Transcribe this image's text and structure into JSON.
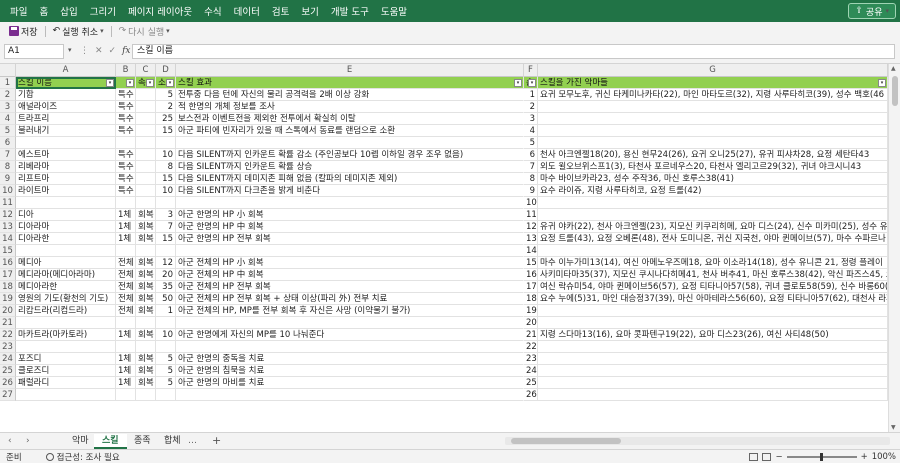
{
  "menu": [
    "파일",
    "홈",
    "삽입",
    "그리기",
    "페이지 레이아웃",
    "수식",
    "데이터",
    "검토",
    "보기",
    "개발 도구",
    "도움말"
  ],
  "share_label": "공유",
  "toolbar": {
    "save": "저장",
    "undo": "실행 취소",
    "redo": "다시 실행"
  },
  "namebox": "A1",
  "formula": "스킬 이름",
  "columns": [
    "A",
    "B",
    "C",
    "D",
    "E",
    "F",
    "G"
  ],
  "header": [
    "스킬 이름",
    "",
    "속",
    "소",
    "스킬 효과",
    "순",
    "스킬을 가진 악마들"
  ],
  "rows": [
    [
      "2",
      "기합",
      "특수",
      "",
      "5",
      "전투중 다음 턴에 자신의 물리 공격력을 2배 이상 강화",
      "1",
      "요귀 모무노후, 귀신 타케미나카타(22), 마인 마타도르(32), 지령 사루타히코(39), 성수 백호(46"
    ],
    [
      "3",
      "애널라이즈",
      "특수",
      "",
      "2",
      "적 한명의 개체 정보를 조사",
      "2",
      ""
    ],
    [
      "4",
      "트라프리",
      "특수",
      "",
      "25",
      "보스전과 이벤트전을 제외한 전투에서 확실히 이탈",
      "3",
      ""
    ],
    [
      "5",
      "불러내기",
      "특수",
      "",
      "15",
      "아군 파티에 빈자리가 있을 때 스톡에서 동료를 랜덤으로 소환",
      "4",
      ""
    ],
    [
      "6",
      "",
      "",
      "",
      "",
      "",
      "5",
      ""
    ],
    [
      "7",
      "에스트마",
      "특수",
      "",
      "10",
      "다음 SILENT까지 인카운트 확률 감소 (주인공보다 10렙 이하일 경우 조우 없음)",
      "6",
      "천사 아크엔젤18(20), 용신 현무24(26), 요귀 오니25(27), 유귀 피샤차28, 요정 세탄타43"
    ],
    [
      "8",
      "리베라마",
      "특수",
      "",
      "8",
      "다음 SILENT까지 인카운트 확률 상승",
      "7",
      "외도 윌오브위스프1(3), 타천사 포르네우스20, 타천사 엘리고르29(32), 귀녀 야크시니43"
    ],
    [
      "9",
      "리프트마",
      "특수",
      "",
      "15",
      "다음 SILENT까지 데미지존 피해 없음 (칼파의 데미지존 제외)",
      "8",
      "마수 바이브카라23, 성수 주작36, 마신 호루스38(41)"
    ],
    [
      "10",
      "라이트마",
      "특수",
      "",
      "10",
      "다음 SILENT까지 다크존을 밝게 비춘다",
      "9",
      "요수 라이쥬, 지령 사루타히코, 요정 트롤(42)"
    ],
    [
      "11",
      "",
      "",
      "",
      "",
      "",
      "10",
      ""
    ],
    [
      "12",
      "디아",
      "1체",
      "회복",
      "3",
      "아군 한명의 HP 小 회복",
      "11",
      ""
    ],
    [
      "13",
      "디아라마",
      "1체",
      "회복",
      "7",
      "아군 한명의 HP 中 회복",
      "12",
      "유귀 야카(22), 천사 아크엔젤(23), 지모신 키쿠리히메, 요마 디스(24), 신수 미카미(25), 성수 유니"
    ],
    [
      "14",
      "디아라한",
      "1체",
      "회복",
      "15",
      "아군 한명의 HP 전부 회복",
      "13",
      "요정 트롤(43), 요정 오베론(48), 전사 도미니온, 귀신 지국천, 야마 퀸메이브(57), 마수 수파르나"
    ],
    [
      "15",
      "",
      "",
      "",
      "",
      "",
      "14",
      ""
    ],
    [
      "16",
      "메디아",
      "전체",
      "회복",
      "12",
      "아군 전체의 HP 小 회복",
      "15",
      "마수 이누가미13(14), 여신 아메노우즈메18, 요마 이소라14(18), 성수 유니콘 21, 정령 플레이"
    ],
    [
      "17",
      "메디라마(메디아라마)",
      "전체",
      "회복",
      "20",
      "아군 전체의 HP 中 회복",
      "16",
      "사키미타마35(37), 지모신 쿠시나다히메41, 천사 버추41, 마신 호루스38(42), 악신 파즈스45, 요"
    ],
    [
      "18",
      "메디아라한",
      "전체",
      "회복",
      "35",
      "아군 전체의 HP 전부 회복",
      "17",
      "여신 락슈미54, 야마 퀸메이브56(57), 요정 티타니아57(58), 귀녀 클로토58(59), 신수 바롱60(6"
    ],
    [
      "19",
      "영원의 기도(황천의 기도)",
      "전체",
      "회복",
      "50",
      "아군 전체의 HP 전부 회복 + 상태 이상(파리 外) 전부 치료",
      "18",
      "요수 누에(5)31, 마인 대승정37(39), 마신 아마테라스56(60), 요정 티타니아57(62), 대천사 라파"
    ],
    [
      "20",
      "리캄드라(리컴드라)",
      "전체",
      "회복",
      "1",
      "아군 전체의 HP, MP를 전부 회복 후 자신은 사망 (이약물기 불가)",
      "19",
      ""
    ],
    [
      "21",
      "",
      "",
      "",
      "",
      "",
      "20",
      ""
    ],
    [
      "22",
      "마카트라(마카토라)",
      "1체",
      "회복",
      "10",
      "아군 한명에게 자신의 MP를 10 나눠준다",
      "21",
      "지령 스다마13(16), 요마 콧파텐구19(22), 요마 디스23(26), 여신 사티48(50)"
    ],
    [
      "23",
      "",
      "",
      "",
      "",
      "",
      "22",
      ""
    ],
    [
      "24",
      "포즈디",
      "1체",
      "회복",
      "5",
      "아군 한명의 중독을 치료",
      "23",
      ""
    ],
    [
      "25",
      "클로즈디",
      "1체",
      "회복",
      "5",
      "아군 한명의 침묵을 치료",
      "24",
      ""
    ],
    [
      "26",
      "패럴라디",
      "1체",
      "회복",
      "5",
      "아군 한명의 마비를 치료",
      "25",
      ""
    ],
    [
      "27",
      "",
      "",
      "",
      "",
      "",
      "26",
      ""
    ]
  ],
  "sheets": [
    "악마",
    "스킬",
    "종족",
    "합체"
  ],
  "active_sheet": "스킬",
  "status": {
    "ready": "준비",
    "accessibility": "접근성: 조사 필요",
    "zoom": "100%"
  }
}
